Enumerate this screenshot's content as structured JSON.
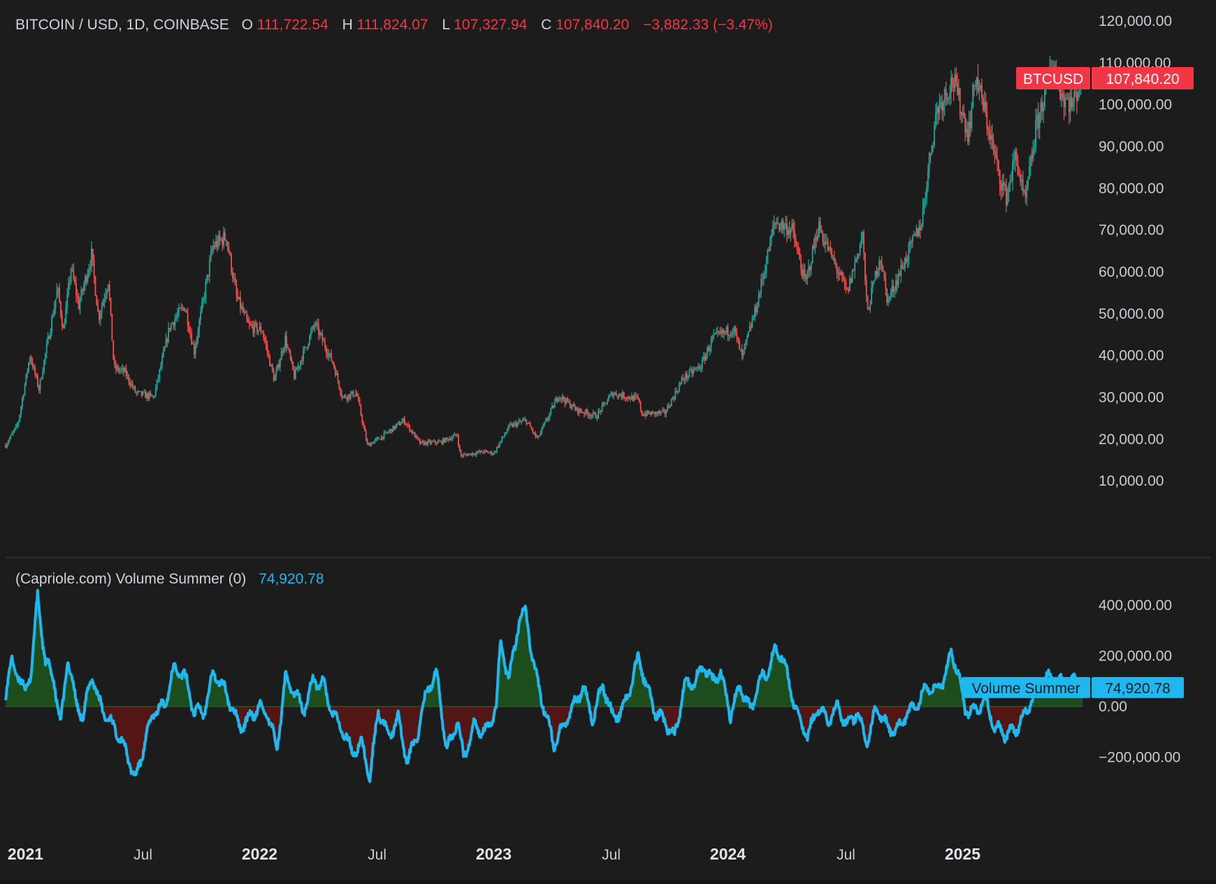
{
  "header": {
    "symbol": "BITCOIN / USD, 1D, COINBASE",
    "open_label": "O",
    "open": "111,722.54",
    "high_label": "H",
    "high": "111,824.07",
    "low_label": "L",
    "low": "107,327.94",
    "close_label": "C",
    "close": "107,840.20",
    "change": "−3,882.33 (−3.47%)"
  },
  "price_badge": {
    "name": "BTCUSD",
    "value": "107,840.20"
  },
  "indicator": {
    "title": "(Capriole.com) Volume Summer (0)",
    "value": "74,920.78",
    "badge_name": "Volume Summer",
    "badge_value": "74,920.78"
  },
  "colors": {
    "background": "#1c1c1c",
    "up_candle": "#26a69a",
    "down_candle": "#ef5350",
    "indicator_line": "#1fb8ee",
    "fill_positive": "#1d4d1d",
    "fill_negative": "#541515",
    "badge_red": "#f23645",
    "text": "#d1d4dc"
  },
  "chart_data": [
    {
      "type": "candlestick",
      "series": [
        {
          "name": "BTCUSD"
        }
      ],
      "ylim": [
        0,
        120000
      ],
      "y_ticks": [
        "120,000.00",
        "110,000.00",
        "100,000.00",
        "90,000.00",
        "80,000.00",
        "70,000.00",
        "60,000.00",
        "50,000.00",
        "40,000.00",
        "30,000.00",
        "20,000.00",
        "10,000.00"
      ],
      "x_ticks": [
        "2021",
        "Jul",
        "2022",
        "Jul",
        "2023",
        "Jul",
        "2024",
        "Jul",
        "2025"
      ],
      "xlim": [
        "2020-12-01",
        "2025-07-08"
      ],
      "points": [
        [
          "2020-12-01",
          18500
        ],
        [
          "2020-12-20",
          23500
        ],
        [
          "2021-01-08",
          40000
        ],
        [
          "2021-01-22",
          32000
        ],
        [
          "2021-02-20",
          56000
        ],
        [
          "2021-03-01",
          46000
        ],
        [
          "2021-03-13",
          61000
        ],
        [
          "2021-03-25",
          52000
        ],
        [
          "2021-04-14",
          64000
        ],
        [
          "2021-04-25",
          49000
        ],
        [
          "2021-05-10",
          58000
        ],
        [
          "2021-05-19",
          37000
        ],
        [
          "2021-06-05",
          36000
        ],
        [
          "2021-06-22",
          31000
        ],
        [
          "2021-07-20",
          30000
        ],
        [
          "2021-08-14",
          47000
        ],
        [
          "2021-09-06",
          52000
        ],
        [
          "2021-09-21",
          41000
        ],
        [
          "2021-10-20",
          66000
        ],
        [
          "2021-11-10",
          68500
        ],
        [
          "2021-11-26",
          54000
        ],
        [
          "2021-12-15",
          47000
        ],
        [
          "2022-01-05",
          46000
        ],
        [
          "2022-01-24",
          34000
        ],
        [
          "2022-02-10",
          44000
        ],
        [
          "2022-02-24",
          35000
        ],
        [
          "2022-03-28",
          47500
        ],
        [
          "2022-04-26",
          38000
        ],
        [
          "2022-05-10",
          30000
        ],
        [
          "2022-06-01",
          31000
        ],
        [
          "2022-06-18",
          18500
        ],
        [
          "2022-07-10",
          20500
        ],
        [
          "2022-08-14",
          24500
        ],
        [
          "2022-09-08",
          19000
        ],
        [
          "2022-10-10",
          19300
        ],
        [
          "2022-11-05",
          21000
        ],
        [
          "2022-11-10",
          16000
        ],
        [
          "2022-12-15",
          17000
        ],
        [
          "2023-01-01",
          16600
        ],
        [
          "2023-01-25",
          23000
        ],
        [
          "2023-02-20",
          24500
        ],
        [
          "2023-03-10",
          20000
        ],
        [
          "2023-04-12",
          30500
        ],
        [
          "2023-05-10",
          27000
        ],
        [
          "2023-06-10",
          25500
        ],
        [
          "2023-07-05",
          31000
        ],
        [
          "2023-08-14",
          29500
        ],
        [
          "2023-08-20",
          26000
        ],
        [
          "2023-09-25",
          26300
        ],
        [
          "2023-10-23",
          34500
        ],
        [
          "2023-11-20",
          37500
        ],
        [
          "2023-12-08",
          44000
        ],
        [
          "2024-01-10",
          46500
        ],
        [
          "2024-01-23",
          39500
        ],
        [
          "2024-02-15",
          52000
        ],
        [
          "2024-03-14",
          72000
        ],
        [
          "2024-04-10",
          70000
        ],
        [
          "2024-05-01",
          57000
        ],
        [
          "2024-05-21",
          71000
        ],
        [
          "2024-07-05",
          55000
        ],
        [
          "2024-07-29",
          69000
        ],
        [
          "2024-08-05",
          50000
        ],
        [
          "2024-08-25",
          64000
        ],
        [
          "2024-09-06",
          53000
        ],
        [
          "2024-10-01",
          62000
        ],
        [
          "2024-10-29",
          72000
        ],
        [
          "2024-11-12",
          89000
        ],
        [
          "2024-11-22",
          99000
        ],
        [
          "2024-12-17",
          106000
        ],
        [
          "2025-01-10",
          93000
        ],
        [
          "2025-01-21",
          107000
        ],
        [
          "2025-02-05",
          98000
        ],
        [
          "2025-02-27",
          83000
        ],
        [
          "2025-03-10",
          78000
        ],
        [
          "2025-03-25",
          88000
        ],
        [
          "2025-04-08",
          76000
        ],
        [
          "2025-04-25",
          94000
        ],
        [
          "2025-05-22",
          111000
        ],
        [
          "2025-06-05",
          102000
        ],
        [
          "2025-06-22",
          100000
        ],
        [
          "2025-07-07",
          107840
        ]
      ]
    },
    {
      "type": "line",
      "series": [
        {
          "name": "Volume Summer"
        }
      ],
      "ylim": [
        -300000,
        430000
      ],
      "y_ticks": [
        "400,000.00",
        "200,000.00",
        "0.00",
        "−200,000.00"
      ],
      "x_ticks": [
        "2021",
        "Jul",
        "2022",
        "Jul",
        "2023",
        "Jul",
        "2024",
        "Jul",
        "2025"
      ],
      "xlim": [
        "2020-12-01",
        "2025-07-08"
      ],
      "points": [
        [
          "2020-12-01",
          60000
        ],
        [
          "2020-12-10",
          170000
        ],
        [
          "2020-12-22",
          120000
        ],
        [
          "2021-01-01",
          50000
        ],
        [
          "2021-01-10",
          150000
        ],
        [
          "2021-01-20",
          430000
        ],
        [
          "2021-02-01",
          180000
        ],
        [
          "2021-02-15",
          100000
        ],
        [
          "2021-02-25",
          -80000
        ],
        [
          "2021-03-08",
          200000
        ],
        [
          "2021-03-20",
          20000
        ],
        [
          "2021-04-01",
          -40000
        ],
        [
          "2021-04-15",
          130000
        ],
        [
          "2021-04-25",
          20000
        ],
        [
          "2021-05-10",
          -50000
        ],
        [
          "2021-05-25",
          -100000
        ],
        [
          "2021-06-10",
          -200000
        ],
        [
          "2021-06-22",
          -290000
        ],
        [
          "2021-07-05",
          -150000
        ],
        [
          "2021-07-20",
          -20000
        ],
        [
          "2021-08-05",
          0
        ],
        [
          "2021-08-20",
          150000
        ],
        [
          "2021-09-05",
          130000
        ],
        [
          "2021-09-20",
          -10000
        ],
        [
          "2021-10-05",
          -30000
        ],
        [
          "2021-10-20",
          130000
        ],
        [
          "2021-11-01",
          100000
        ],
        [
          "2021-11-15",
          20000
        ],
        [
          "2021-12-01",
          -80000
        ],
        [
          "2021-12-15",
          -50000
        ],
        [
          "2022-01-01",
          0
        ],
        [
          "2022-01-15",
          -40000
        ],
        [
          "2022-01-28",
          -170000
        ],
        [
          "2022-02-10",
          110000
        ],
        [
          "2022-02-25",
          60000
        ],
        [
          "2022-03-10",
          -20000
        ],
        [
          "2022-03-25",
          100000
        ],
        [
          "2022-04-10",
          90000
        ],
        [
          "2022-04-25",
          -30000
        ],
        [
          "2022-05-12",
          -100000
        ],
        [
          "2022-05-25",
          -180000
        ],
        [
          "2022-06-10",
          -150000
        ],
        [
          "2022-06-22",
          -280000
        ],
        [
          "2022-07-05",
          -10000
        ],
        [
          "2022-07-20",
          -120000
        ],
        [
          "2022-08-05",
          -50000
        ],
        [
          "2022-08-20",
          -220000
        ],
        [
          "2022-09-05",
          -100000
        ],
        [
          "2022-09-20",
          80000
        ],
        [
          "2022-10-05",
          120000
        ],
        [
          "2022-10-20",
          -180000
        ],
        [
          "2022-11-05",
          -50000
        ],
        [
          "2022-11-15",
          -200000
        ],
        [
          "2022-12-01",
          -80000
        ],
        [
          "2022-12-20",
          -100000
        ],
        [
          "2023-01-05",
          0
        ],
        [
          "2023-01-12",
          260000
        ],
        [
          "2023-01-25",
          100000
        ],
        [
          "2023-02-10",
          350000
        ],
        [
          "2023-02-20",
          380000
        ],
        [
          "2023-03-05",
          150000
        ],
        [
          "2023-03-20",
          0
        ],
        [
          "2023-04-05",
          -150000
        ],
        [
          "2023-04-20",
          -80000
        ],
        [
          "2023-05-05",
          0
        ],
        [
          "2023-05-20",
          80000
        ],
        [
          "2023-06-05",
          -50000
        ],
        [
          "2023-06-20",
          90000
        ],
        [
          "2023-07-05",
          -40000
        ],
        [
          "2023-07-20",
          -20000
        ],
        [
          "2023-08-05",
          100000
        ],
        [
          "2023-08-15",
          200000
        ],
        [
          "2023-08-25",
          100000
        ],
        [
          "2023-09-10",
          -20000
        ],
        [
          "2023-09-25",
          -60000
        ],
        [
          "2023-10-10",
          -120000
        ],
        [
          "2023-10-25",
          80000
        ],
        [
          "2023-11-10",
          100000
        ],
        [
          "2023-11-25",
          160000
        ],
        [
          "2023-12-08",
          100000
        ],
        [
          "2023-12-20",
          140000
        ],
        [
          "2024-01-05",
          -30000
        ],
        [
          "2024-01-20",
          80000
        ],
        [
          "2024-02-05",
          -20000
        ],
        [
          "2024-02-20",
          100000
        ],
        [
          "2024-03-05",
          150000
        ],
        [
          "2024-03-15",
          220000
        ],
        [
          "2024-03-25",
          200000
        ],
        [
          "2024-04-05",
          100000
        ],
        [
          "2024-04-20",
          -50000
        ],
        [
          "2024-05-05",
          -120000
        ],
        [
          "2024-05-20",
          0
        ],
        [
          "2024-06-05",
          -50000
        ],
        [
          "2024-06-20",
          0
        ],
        [
          "2024-07-05",
          -80000
        ],
        [
          "2024-07-20",
          -20000
        ],
        [
          "2024-08-05",
          -150000
        ],
        [
          "2024-08-20",
          0
        ],
        [
          "2024-09-05",
          -80000
        ],
        [
          "2024-09-20",
          -100000
        ],
        [
          "2024-10-05",
          -30000
        ],
        [
          "2024-10-25",
          20000
        ],
        [
          "2024-11-05",
          80000
        ],
        [
          "2024-11-20",
          60000
        ],
        [
          "2024-12-05",
          120000
        ],
        [
          "2024-12-15",
          220000
        ],
        [
          "2024-12-25",
          130000
        ],
        [
          "2025-01-05",
          -10000
        ],
        [
          "2025-01-20",
          -20000
        ],
        [
          "2025-02-05",
          30000
        ],
        [
          "2025-02-20",
          -80000
        ],
        [
          "2025-03-10",
          -110000
        ],
        [
          "2025-03-25",
          -90000
        ],
        [
          "2025-04-10",
          -20000
        ],
        [
          "2025-04-25",
          60000
        ],
        [
          "2025-05-10",
          110000
        ],
        [
          "2025-05-25",
          120000
        ],
        [
          "2025-06-10",
          80000
        ],
        [
          "2025-06-25",
          100000
        ],
        [
          "2025-07-07",
          74920
        ]
      ]
    }
  ]
}
